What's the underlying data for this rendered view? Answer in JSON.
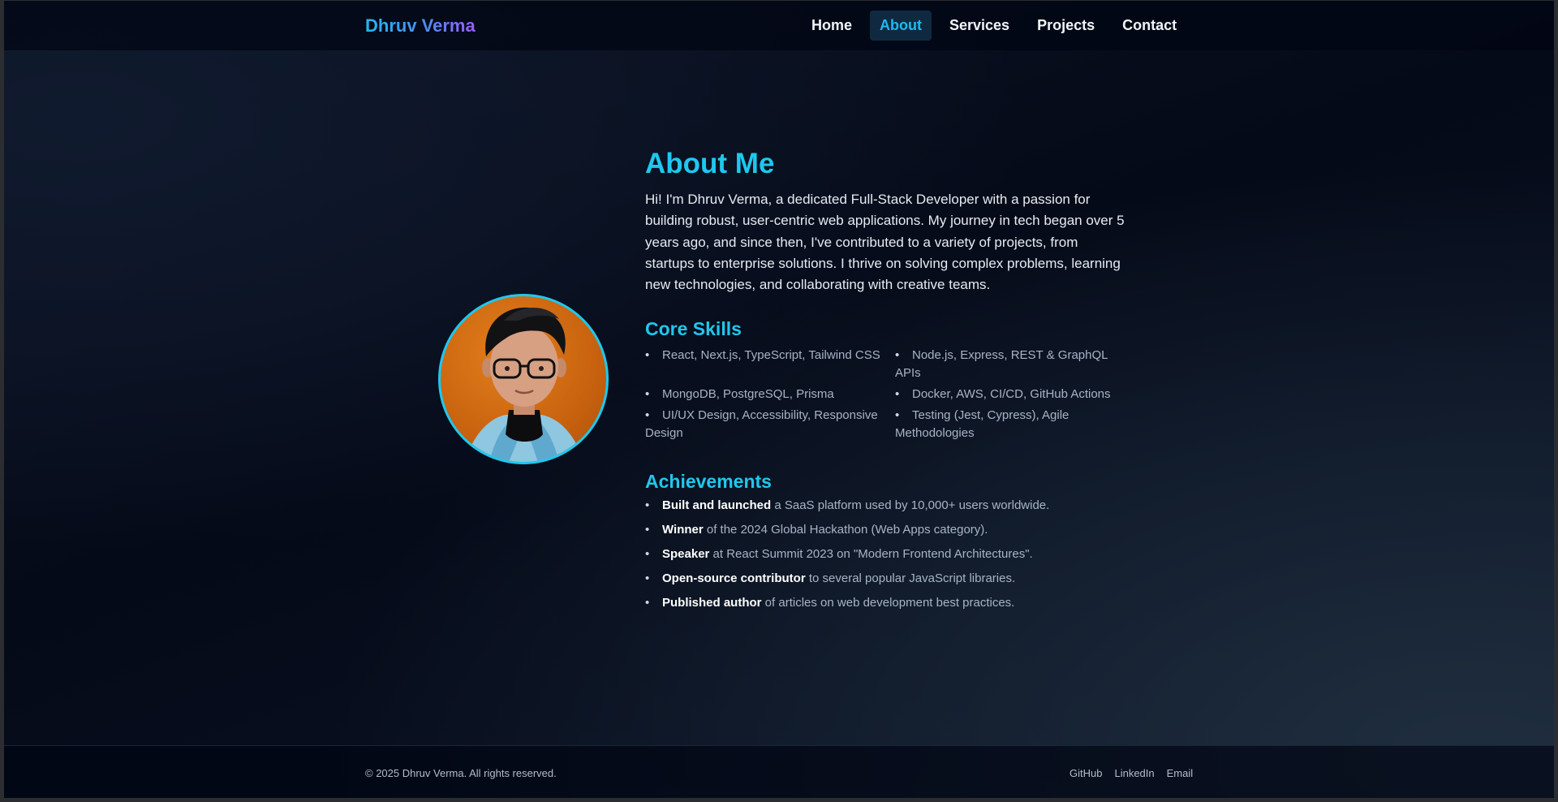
{
  "header": {
    "brand": "Dhruv Verma",
    "nav": [
      "Home",
      "About",
      "Services",
      "Projects",
      "Contact"
    ],
    "active": "About"
  },
  "about": {
    "title": "About Me",
    "bio": "Hi! I'm Dhruv Verma, a dedicated Full-Stack Developer with a passion for building robust, user-centric web applications. My journey in tech began over 5 years ago, and since then, I've contributed to a variety of projects, from startups to enterprise solutions. I thrive on solving complex problems, learning new technologies, and collaborating with creative teams."
  },
  "skills": {
    "title": "Core Skills",
    "items": [
      "React, Next.js, TypeScript, Tailwind CSS",
      "Node.js, Express, REST & GraphQL APIs",
      "MongoDB, PostgreSQL, Prisma",
      "Docker, AWS, CI/CD, GitHub Actions",
      "UI/UX Design, Accessibility, Responsive Design",
      "Testing (Jest, Cypress), Agile Methodologies"
    ]
  },
  "achievements": {
    "title": "Achievements",
    "items": [
      {
        "strong": "Built and launched",
        "rest": " a SaaS platform used by 10,000+ users worldwide."
      },
      {
        "strong": "Winner",
        "rest": " of the 2024 Global Hackathon (Web Apps category)."
      },
      {
        "strong": "Speaker",
        "rest": " at React Summit 2023 on \"Modern Frontend Architectures\"."
      },
      {
        "strong": "Open-source contributor",
        "rest": " to several popular JavaScript libraries."
      },
      {
        "strong": "Published author",
        "rest": " of articles on web development best practices."
      }
    ]
  },
  "footer": {
    "copyright": "© 2025 Dhruv Verma. All rights reserved.",
    "links": [
      "GitHub",
      "LinkedIn",
      "Email"
    ]
  },
  "colors": {
    "accent": "#1ec8ee",
    "background": "#050a18",
    "text": "#e6ebf2",
    "muted": "#a7b4c5"
  },
  "icons": {
    "avatar": "profile-photo"
  }
}
